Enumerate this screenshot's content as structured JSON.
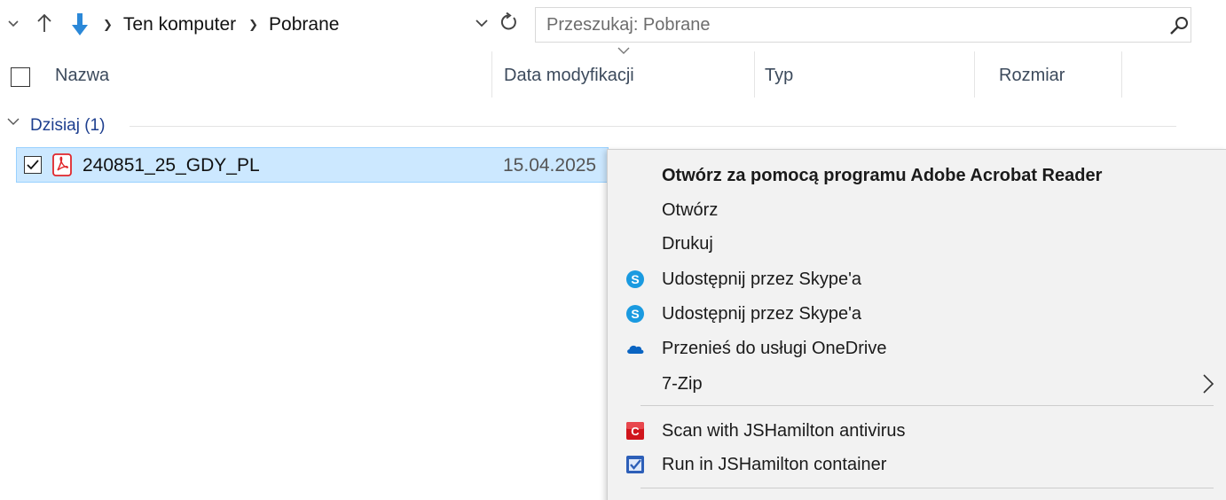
{
  "address_bar": {
    "breadcrumbs": [
      "Ten komputer",
      "Pobrane"
    ],
    "recent_locations_icon": "chevron-down-icon",
    "up_icon": "arrow-up-icon",
    "folder_icon": "download-arrow-icon",
    "dropdown_icon": "chevron-down-icon",
    "refresh_icon": "refresh-icon"
  },
  "search": {
    "placeholder": "Przeszukaj: Pobrane",
    "value": "",
    "icon": "search-icon"
  },
  "columns": [
    {
      "label": "Nazwa"
    },
    {
      "label": "Data modyfikacji",
      "sorted": true
    },
    {
      "label": "Typ"
    },
    {
      "label": "Rozmiar"
    }
  ],
  "group": {
    "label": "Dzisiaj (1)",
    "icon": "chevron-down-icon"
  },
  "files": [
    {
      "name": "240851_25_GDY_PL",
      "date": "15.04.2025",
      "icon": "pdf-icon",
      "selected": true,
      "checked": true
    }
  ],
  "context_menu": {
    "items": [
      {
        "label": "Otwórz za pomocą programu Adobe Acrobat Reader",
        "bold": true,
        "icon": null
      },
      {
        "label": "Otwórz",
        "icon": null
      },
      {
        "label": "Drukuj",
        "icon": null
      },
      {
        "label": "Udostępnij przez Skype'a",
        "icon": "skype-icon"
      },
      {
        "label": "Udostępnij przez Skype'a",
        "icon": "skype-icon"
      },
      {
        "label": "Przenieś do usługi OneDrive",
        "icon": "onedrive-cloud-icon"
      },
      {
        "label": "7-Zip",
        "icon": null,
        "submenu": true
      },
      {
        "label": "Scan with JSHamilton antivirus",
        "icon": "jshamilton-antivirus-icon"
      },
      {
        "label": "Run in JSHamilton container",
        "icon": "jshamilton-container-icon"
      }
    ]
  },
  "colors": {
    "selection_bg": "#cce8ff",
    "selection_border": "#99d1ff",
    "group_label": "#1e3f8f",
    "download_blue": "#2b88d8",
    "pdf_red": "#e0262b",
    "skype_blue": "#1a9ae0",
    "onedrive_blue": "#0a64c2",
    "jshamilton_red": "#d0151c",
    "jshamilton_blue": "#2d5fb8",
    "menu_bg": "#f2f2f2"
  }
}
